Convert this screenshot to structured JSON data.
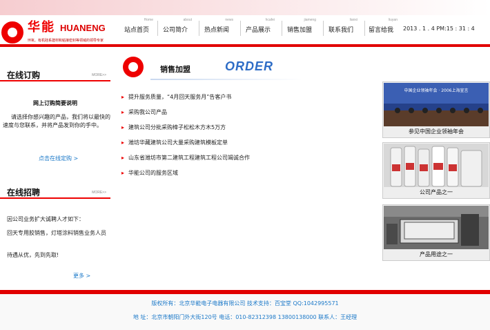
{
  "header": {
    "logo": {
      "cn": "华能",
      "en": "HUANENG",
      "slogan": "环氧、有机硅系建材和粘接密封等领域的领导专家"
    },
    "nav": [
      {
        "en": "Home",
        "cn": "站点首页"
      },
      {
        "en": "about",
        "cn": "公司简介"
      },
      {
        "en": "news",
        "cn": "热点新闻"
      },
      {
        "en": "hcafei",
        "cn": "产品展示"
      },
      {
        "en": "jiameng",
        "cn": "销售加盟"
      },
      {
        "en": "lianxi",
        "cn": "联系我们"
      },
      {
        "en": "liuyan",
        "cn": "留言给我"
      }
    ],
    "datetime": "2013 . 1   . 4     PM:15 : 31 : 4"
  },
  "left": {
    "order": {
      "title": "在线订购",
      "more": "MORE>>",
      "subtitle": "网上订购简要说明",
      "desc": "请选择你感兴趣的产品，我们将以最快的速度与您联系，并将产品发到你的手中。",
      "link": "点击在线定购 >"
    },
    "recruit": {
      "title": "在线招聘",
      "more": "MORE>>",
      "p1": "因公司业务扩大诚聘人才如下：",
      "p2": "回天专用胶销售，灯塔涂料销售业务人员",
      "p3": "待遇从优，先到先取!",
      "link": "更多 >"
    }
  },
  "main": {
    "title": "销售加盟",
    "order_word": "ORDER",
    "news": [
      "提升服务质量，“4月回天服务月”告客户书",
      "采购我公司产品",
      "建筑公司分批采购樟子松松木方木5万方",
      "潍坊华藏建筑公司大量采购建筑模板定单",
      "山东省潍坊市第二建筑工程建筑工程公司竭诚合作",
      "华能公司的服务区域"
    ]
  },
  "right": {
    "pics": [
      {
        "caption": "参见中国企业领袖年会",
        "banner": "中国企业领袖年会 · 2006上海宣言"
      },
      {
        "caption": "公司产品之一"
      },
      {
        "caption": "产品用途之一"
      }
    ]
  },
  "footer": {
    "line1": "版权所有：北京华能电子电器有限公司 技术支持：百宝堂 QQ:1042995571",
    "line2": "地       址：北京市朝阳门外大街120号 电话：010-82312398 13800138000 联系人：王经理"
  },
  "colors": {
    "brand_red": "#e10000",
    "link_blue": "#1a78c8",
    "order_blue": "#2d6cc6"
  }
}
